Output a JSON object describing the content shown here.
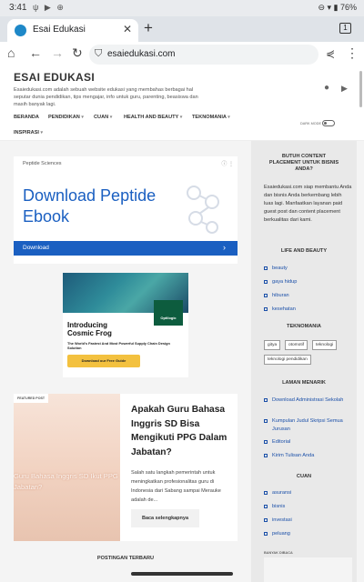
{
  "status": {
    "time": "3:41",
    "battery": "76%",
    "icons": "ψ ▶ ⊕",
    "right_icons": "⊖ ▾ ▮"
  },
  "browser": {
    "tab_title": "Esai Edukasi",
    "tab_count": "1",
    "url": "esaiedukasi.com"
  },
  "site": {
    "title": "ESAI EDUKASI",
    "description": "Esaiedukasi.com adalah sebuah website edukasi yang membahas berbagai hal seputar dunia pendidikan, tips mengajar, info untuk guru, parenting, beasiswa dan masih banyak lagi.",
    "nav": [
      "BERANDA",
      "PENDIDIKAN",
      "CUAN",
      "HEALTH AND BEAUTY",
      "TEKNOMANIA",
      "INSPIRASI"
    ],
    "dark_mode_label": "DARK MODE"
  },
  "ad1": {
    "sponsor": "Peptide Sciences",
    "headline": "Download Peptide Ebook",
    "cta": "Download"
  },
  "ad2": {
    "brand": "Optilogic",
    "headline_line1": "Introducing",
    "headline_line2": "Cosmic Frog",
    "sub": "The World's Fastest And Most Powerful Supply Chain Design Solution",
    "button": "Download our Free Guide"
  },
  "featured": {
    "badge": "FEATURED POST",
    "image_text": "Guru Bahasa Inggris SD Ikut PPG Jabatan?",
    "title": "Apakah Guru Bahasa Inggris SD Bisa Mengikuti PPG Dalam Jabatan?",
    "excerpt": "Salah satu langkah pemerintah untuk meningkatkan profesionalitas guru di Indonesia dari Sabang sampai Merauke adalah de...",
    "more": "Baca selengkapnya"
  },
  "latest_title": "POSTINGAN TERBARU",
  "sidebar": {
    "placement_title": "BUTUH CONTENT PLACEMENT UNTUK BISNIS ANDA?",
    "placement_text": "Esaiedukasi.com siap membantu Anda dan bisnis Anda berkembang lebih luas lagi. Manfaatkan layanan paid guest post dan content placement berkualitas dari kami.",
    "life_title": "LIFE AND BEAUTY",
    "life_items": [
      "beauty",
      "gaya hidup",
      "hiburan",
      "kesehatan"
    ],
    "tekno_title": "TEKNOMANIA",
    "tekno_tags": [
      "gitya",
      "otomotif",
      "teknologi",
      "teknologi pendidikan"
    ],
    "laman_title": "LAMAN MENARIK",
    "laman_items": [
      "Download Administrasi Sekolah",
      "Kumpulan Judul Skripsi Semua Jurusan",
      "Editorial",
      "Kirim Tulisan Anda"
    ],
    "cuan_title": "CUAN",
    "cuan_items": [
      "asuransi",
      "bisnis",
      "investasi",
      "peluang"
    ],
    "popular_title": "BANYAK DIBACA"
  }
}
